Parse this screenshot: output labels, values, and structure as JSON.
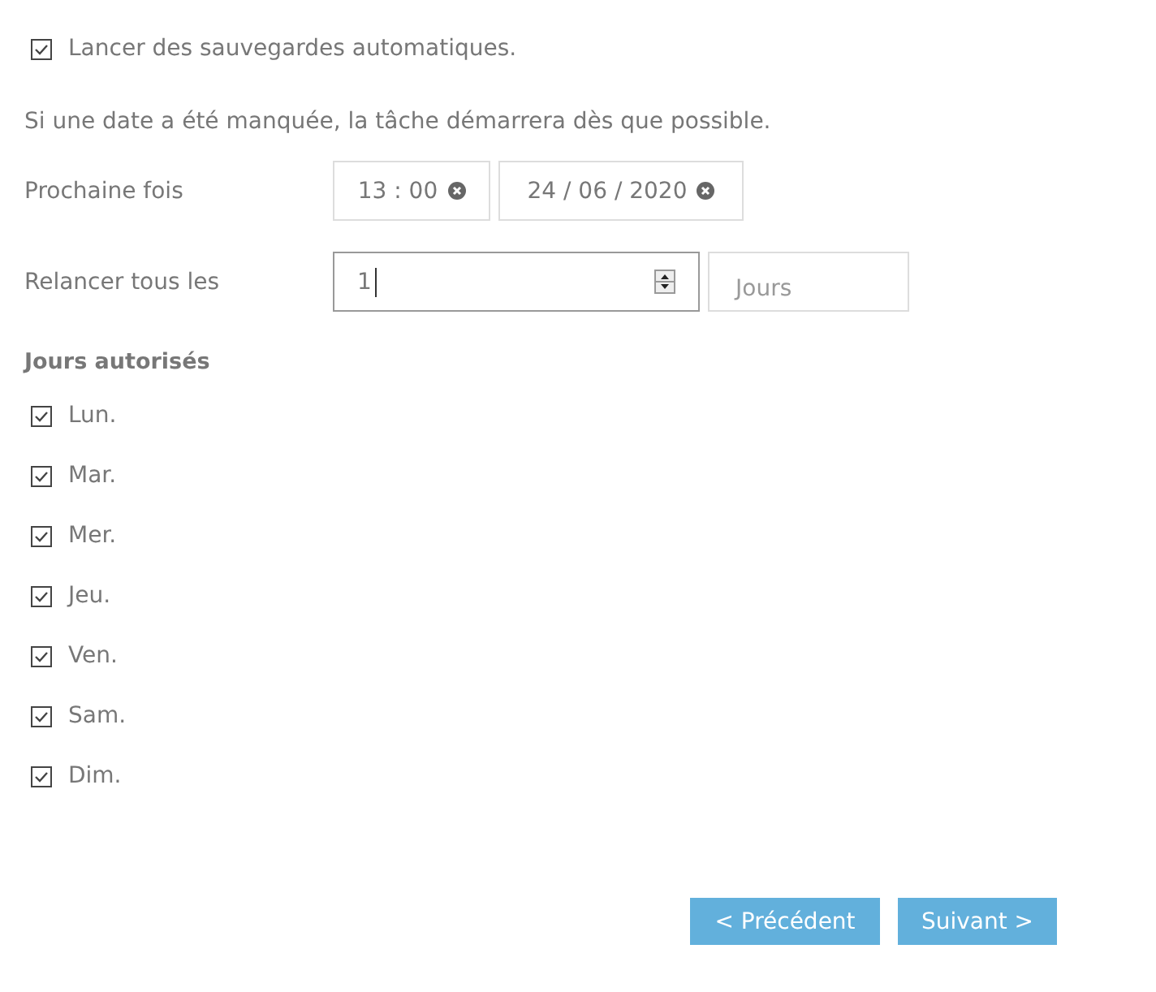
{
  "auto_backup": {
    "label": "Lancer des sauvegardes automatiques.",
    "checked": true
  },
  "note": "Si une date a été manquée, la tâche démarrera dès que possible.",
  "next_time": {
    "label": "Prochaine fois",
    "time": "13 : 00",
    "date": "24 / 06 / 2020"
  },
  "repeat": {
    "label": "Relancer tous les",
    "value": "1",
    "unit": "Jours"
  },
  "days_heading": "Jours autorisés",
  "days": [
    {
      "label": "Lun.",
      "checked": true
    },
    {
      "label": "Mar.",
      "checked": true
    },
    {
      "label": "Mer.",
      "checked": true
    },
    {
      "label": "Jeu.",
      "checked": true
    },
    {
      "label": "Ven.",
      "checked": true
    },
    {
      "label": "Sam.",
      "checked": true
    },
    {
      "label": "Dim.",
      "checked": true
    }
  ],
  "buttons": [
    "< Précédent",
    "Suivant >"
  ]
}
